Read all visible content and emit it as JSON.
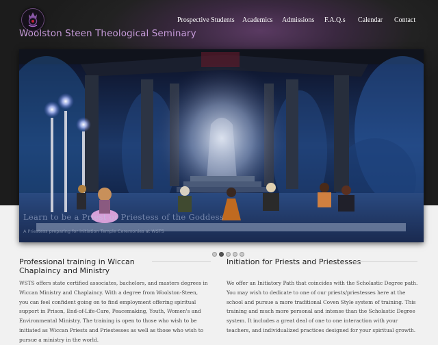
{
  "header": {
    "site_title": "Woolston Steen Theological Seminary",
    "nav": [
      {
        "label": "Prospective Students"
      },
      {
        "label": "Academics"
      },
      {
        "label": "Admissions"
      },
      {
        "label": "F.A.Q.s"
      },
      {
        "label": "Calendar"
      },
      {
        "label": "Contact"
      }
    ]
  },
  "slider": {
    "caption_title": "Learn to be a Priest or Priestess of the Goddess",
    "caption_sub": "A Priestess preparing for initiation Temple Ceremonies at WSTS",
    "slide_count": 5,
    "active_slide": 2
  },
  "sections": [
    {
      "heading": "Professional training in Wiccan Chaplaincy and Ministry",
      "body": "WSTS offers state certified associates, bachelors, and masters degrees in Wiccan Ministry and Chaplaincy. With a degree from Woolston-Steen, you can feel confident going on to find employment offering spiritual support in Prison, End-of-Life-Care, Peacemaking, Youth, Women's and Environmental Ministry. The training is open to those who wish to be initiated as Wiccan Priests and Priestesses as well as those who wish to pursue a ministry in the world."
    },
    {
      "heading": "Initiation for Priests and Priestesses",
      "body": "We offer an Initiatory Path that coincides with the Scholastic Degree path. You may wish to dedicate to one of our priests/priestesses here at the school and pursue a more traditional Coven Style system of training. This training and much more personal and intense than the Scholastic Degree system. It includes a great deal of one to one interaction with your teachers, and individualized practices designed for your spiritual growth."
    }
  ],
  "colors": {
    "title_accent": "#c79bda",
    "header_bg": "#1c1c1c",
    "body_bg": "#f1f1f1"
  }
}
